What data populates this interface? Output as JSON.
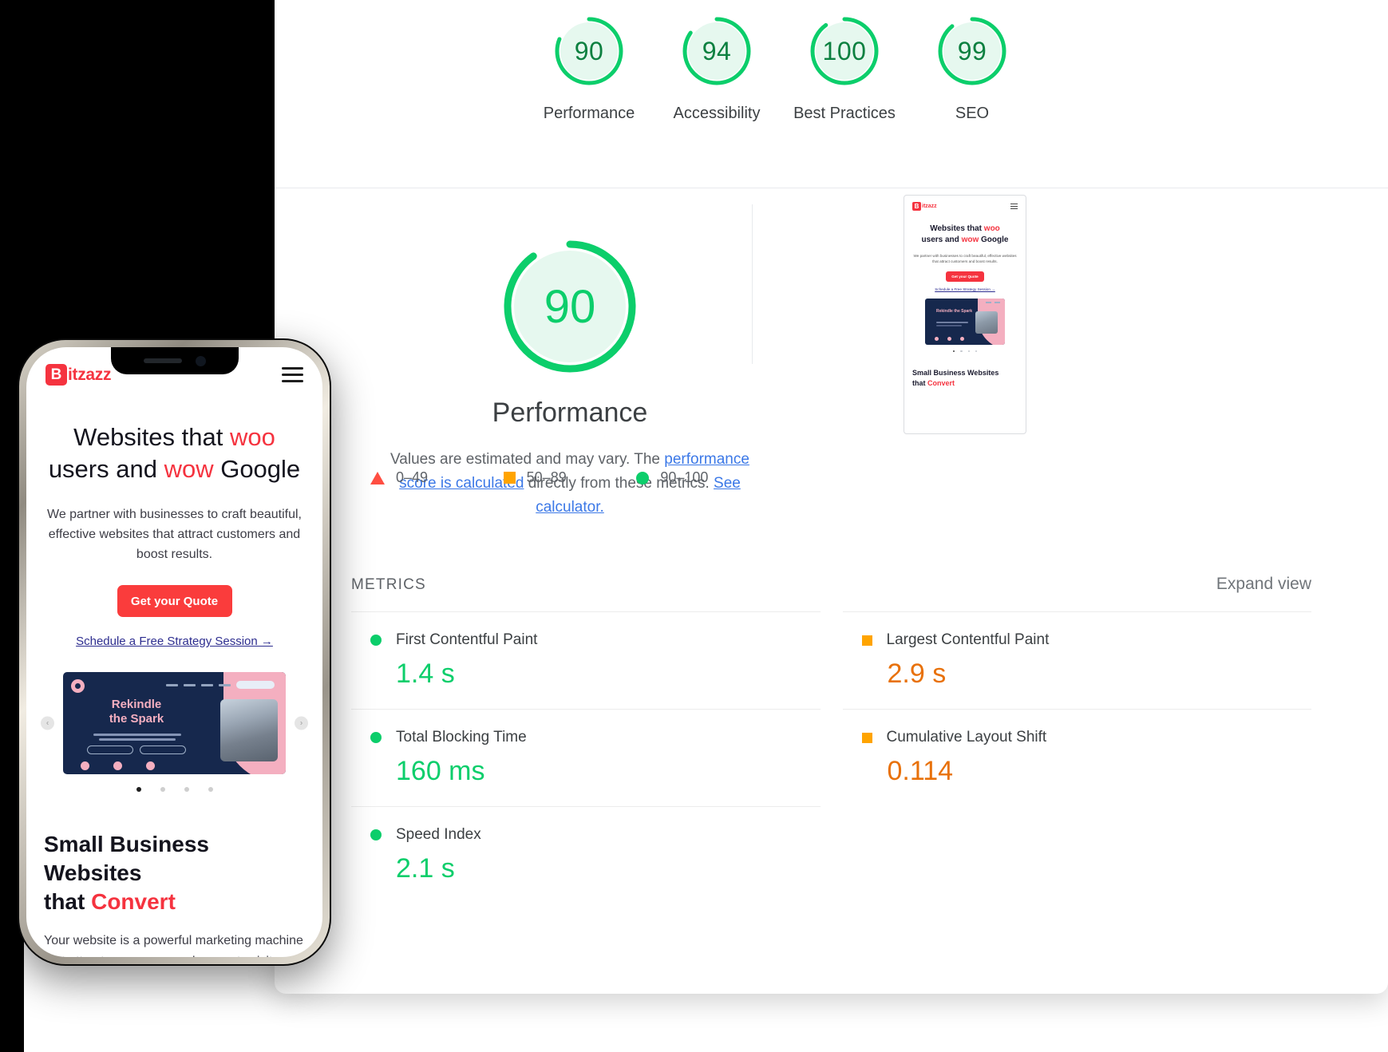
{
  "report": {
    "top_gauges": [
      {
        "score": "90",
        "label": "Performance",
        "pct": 90,
        "color": "#0cce6b"
      },
      {
        "score": "94",
        "label": "Accessibility",
        "pct": 94,
        "color": "#0cce6b"
      },
      {
        "score": "100",
        "label": "Best Practices",
        "pct": 100,
        "color": "#0cce6b"
      },
      {
        "score": "99",
        "label": "SEO",
        "pct": 99,
        "color": "#0cce6b"
      }
    ],
    "main_score": {
      "value": "90",
      "title": "Performance",
      "pct": 90,
      "color": "#0cce6b"
    },
    "description": {
      "part1": "Values are estimated and may vary. The ",
      "link1": "performance score is calculated",
      "part2": " directly from these metrics. ",
      "link2": "See calculator."
    },
    "legend": [
      {
        "shape": "triangle",
        "range": "0–49",
        "color": "#ff4e42"
      },
      {
        "shape": "square",
        "range": "50–89",
        "color": "#ffa400"
      },
      {
        "shape": "circle",
        "range": "90–100",
        "color": "#0cce6b"
      }
    ],
    "metrics_header": {
      "title": "METRICS",
      "expand_label": "Expand view"
    },
    "metrics": [
      {
        "name": "First Contentful Paint",
        "value": "1.4 s",
        "shape": "circle",
        "rating": "good"
      },
      {
        "name": "Largest Contentful Paint",
        "value": "2.9 s",
        "shape": "square",
        "rating": "avg"
      },
      {
        "name": "Total Blocking Time",
        "value": "160 ms",
        "shape": "circle",
        "rating": "good"
      },
      {
        "name": "Cumulative Layout Shift",
        "value": "0.114",
        "shape": "square",
        "rating": "avg"
      },
      {
        "name": "Speed Index",
        "value": "2.1 s",
        "shape": "circle",
        "rating": "good"
      }
    ]
  },
  "thumbnail": {
    "logo_badge": "B",
    "logo_text": "itzazz",
    "heading_a": "Websites that ",
    "heading_b": "woo",
    "heading_c": "users and ",
    "heading_d": "wow",
    "heading_e": " Google",
    "paragraph": "We partner with businesses to craft beautiful, effective websites that attract customers and boost results.",
    "cta": "Get your Quote",
    "link": "Schedule a Free Strategy Session →",
    "slide_title": "Rekindle the Spark",
    "heading2_a": "Small Business Websites",
    "heading2_b": "that ",
    "heading2_c": "Convert"
  },
  "phone": {
    "logo_badge": "B",
    "logo_text": "itzazz",
    "heading_line1_a": "Websites that ",
    "heading_line1_b": "woo",
    "heading_line2_a": "users and ",
    "heading_line2_b": "wow",
    "heading_line2_c": " Google",
    "paragraph": "We partner with businesses to craft beautiful, effective websites that attract customers and boost results.",
    "cta": "Get your Quote",
    "link": "Schedule a Free Strategy Session →",
    "carousel": {
      "slide_title_line1": "Rekindle",
      "slide_title_line2": "the Spark",
      "prev_arrow": "‹",
      "next_arrow": "›",
      "dots": 4,
      "active_dot": 0
    },
    "heading2_line1": "Small Business Websites",
    "heading2_line2_a": "that ",
    "heading2_line2_b": "Convert",
    "paragraph2": "Your website is a powerful marketing machine that attracts, engages, and converts visitors"
  }
}
